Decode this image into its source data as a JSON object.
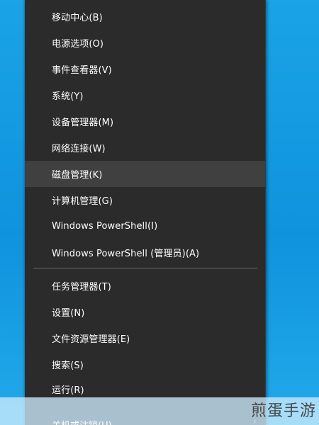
{
  "menu": {
    "items": [
      {
        "label": "移动中心(B)"
      },
      {
        "label": "电源选项(O)"
      },
      {
        "label": "事件查看器(V)"
      },
      {
        "label": "系统(Y)"
      },
      {
        "label": "设备管理器(M)"
      },
      {
        "label": "网络连接(W)"
      },
      {
        "label": "磁盘管理(K)"
      },
      {
        "label": "计算机管理(G)"
      },
      {
        "label": "Windows PowerShell(I)"
      },
      {
        "label": "Windows PowerShell (管理员)(A)"
      },
      {
        "label": "任务管理器(T)"
      },
      {
        "label": "设置(N)"
      },
      {
        "label": "文件资源管理器(E)"
      },
      {
        "label": "搜索(S)"
      },
      {
        "label": "运行(R)"
      }
    ],
    "bottom": {
      "label": "关机或注销(U)",
      "arrow": "›"
    }
  },
  "watermark": {
    "text": "煎蛋手游"
  }
}
